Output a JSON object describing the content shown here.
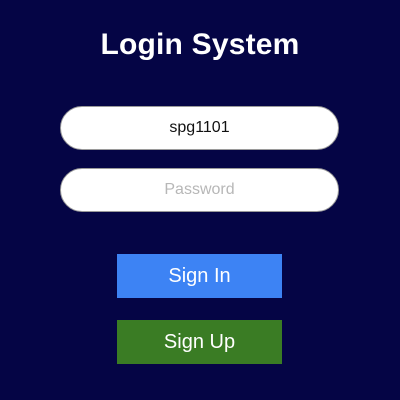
{
  "title": "Login System",
  "form": {
    "username_value": "spg1101",
    "password_value": "",
    "password_placeholder": "Password"
  },
  "buttons": {
    "sign_in": "Sign In",
    "sign_up": "Sign Up"
  },
  "colors": {
    "background": "#050545",
    "sign_in": "#3d83f4",
    "sign_up": "#3a7c24",
    "field_bg": "#ffffff"
  }
}
